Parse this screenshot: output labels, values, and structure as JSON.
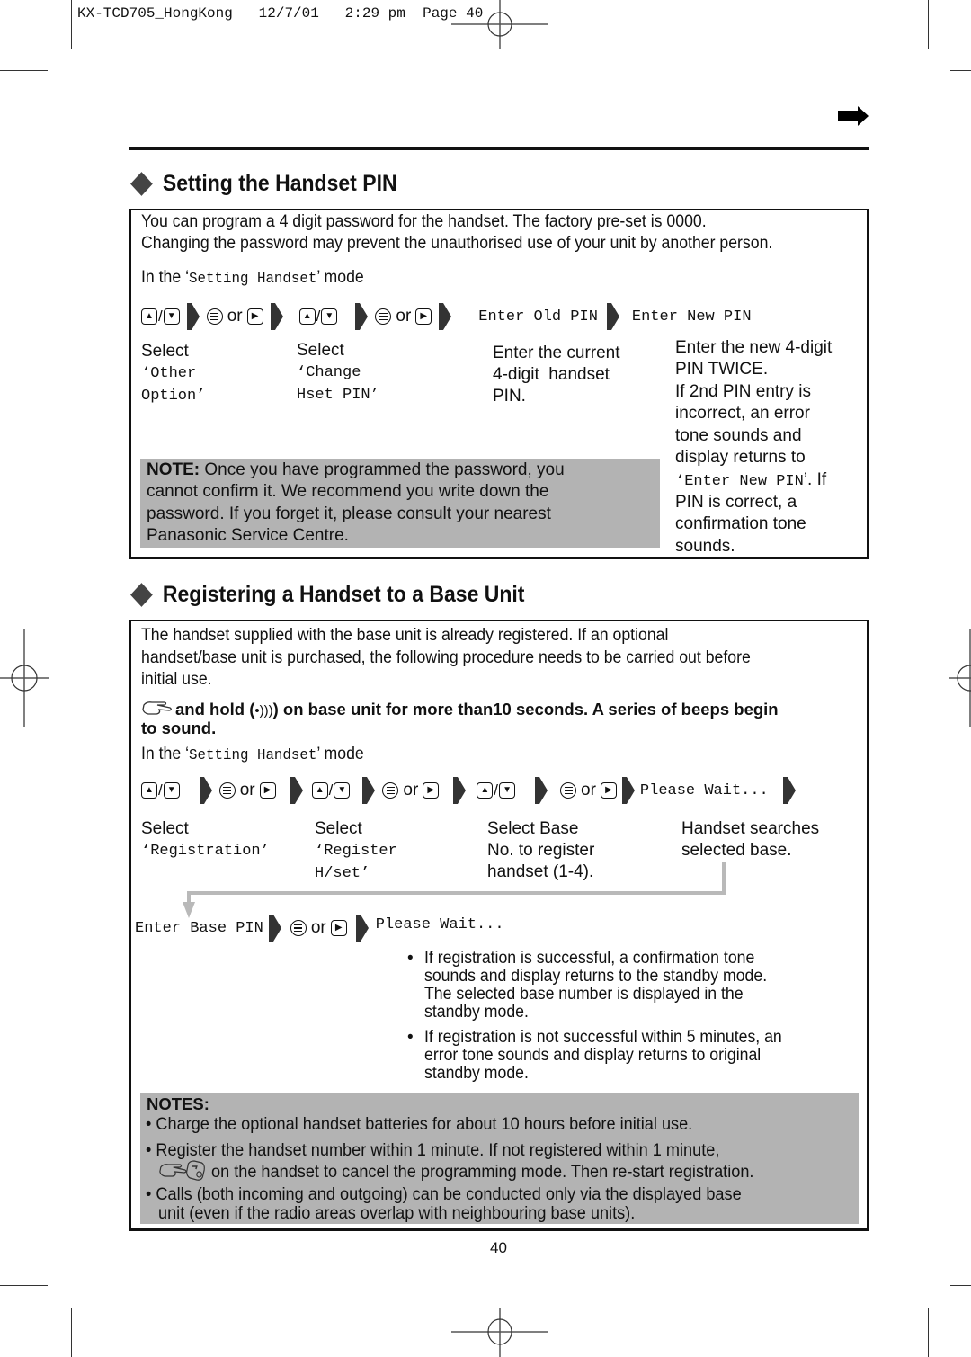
{
  "print_header": {
    "model": "KX-TCD705_HongKong",
    "date": "12/7/01",
    "time": "2:29 pm",
    "page_label": "Page 40"
  },
  "continue_icon": "right-arrow-icon",
  "section_pin": {
    "title": "Setting the Handset PIN",
    "intro_line1": "You can program a 4 digit password for the handset. The factory pre-set is 0000.",
    "intro_line2": "Changing the password may prevent the unauthorised use of your unit by another person.",
    "mode_prefix": "In the ‘",
    "mode_name": "Setting Handset",
    "mode_suffix": "’ mode",
    "or_label": "or",
    "display_old_pin": "Enter Old PIN",
    "display_new_pin": "Enter New PIN",
    "steps": [
      {
        "label": "Select",
        "value_line1": "‘Other",
        "value_line2": "Option’"
      },
      {
        "label": "Select",
        "value_line1": "‘Change",
        "value_line2": "Hset PIN’"
      },
      {
        "line1": "Enter the current",
        "line2": "4-digit  handset",
        "line3": "PIN."
      },
      {
        "line1": "Enter the new 4-digit",
        "line2": "PIN TWICE.",
        "line3": "If 2nd PIN entry is",
        "line4": "incorrect, an error",
        "line5": "tone sounds and",
        "line6": "display returns to",
        "line7_mono": "‘Enter New PIN",
        "line7_tail": "’. If",
        "line8": "PIN is correct, a",
        "line9": "confirmation tone",
        "line10": "sounds."
      }
    ],
    "note": {
      "label": "NOTE:",
      "line1": " Once you have programmed the password, you",
      "line2": "cannot confirm it. We recommend you write down the",
      "line3": "password. If you forget it, please consult your nearest",
      "line4": "Panasonic Service Centre."
    }
  },
  "section_register": {
    "title": "Registering a Handset to a Base Unit",
    "intro_line1": "The handset supplied with the base unit is already registered. If an optional",
    "intro_line2": "handset/base unit is purchased, the following procedure needs to be carried out before",
    "intro_line3": "initial use.",
    "instruction_line1": "and hold (",
    "instruction_line1b": ") on base unit for more than10 seconds. A series of beeps begin",
    "instruction_line2": "to sound.",
    "mode_prefix": "In the ‘",
    "mode_name": "Setting Handset",
    "mode_suffix": "’ mode",
    "or_label": "or",
    "display_please_wait": "Please Wait...",
    "display_enter_base_pin": "Enter Base PIN",
    "steps": [
      {
        "label": "Select",
        "value_line1": "‘Registration’"
      },
      {
        "label": "Select",
        "value_line1": "‘Register",
        "value_line2": "H/set’"
      },
      {
        "line1": "Select Base",
        "line2": "No. to register",
        "line3": "handset (1-4)."
      },
      {
        "line1": "Handset searches",
        "line2": "selected base."
      }
    ],
    "results": [
      {
        "line1": "If registration is successful, a confirmation tone",
        "line2": "sounds and display returns to the standby mode.",
        "line3": "The selected base number is displayed in the",
        "line4": "standby mode."
      },
      {
        "line1": "If registration is not successful within 5 minutes, an",
        "line2": "error tone sounds and display returns to original",
        "line3": "standby mode."
      }
    ],
    "notes": {
      "label": "NOTES:",
      "items": [
        {
          "line1": "• Charge the optional handset batteries for about 10 hours before initial use."
        },
        {
          "line1": "• Register the handset number within 1 minute. If not registered within 1 minute,",
          "line2": " on the handset to cancel the programming mode. Then re-start registration."
        },
        {
          "line1": "• Calls (both incoming and outgoing) can be conducted only via the displayed base",
          "line2": "unit (even if the radio areas overlap with neighbouring base units)."
        }
      ]
    }
  },
  "page_number": "40",
  "icons": {
    "up_key": "up-key-icon",
    "down_key": "down-key-icon",
    "menu_key": "menu-key-icon",
    "right_key": "right-key-icon",
    "step_arrow": "step-arrow-icon",
    "press_hand": "press-hand-icon",
    "locator_button": "locator-signal-icon",
    "off_key": "off-key-icon"
  }
}
